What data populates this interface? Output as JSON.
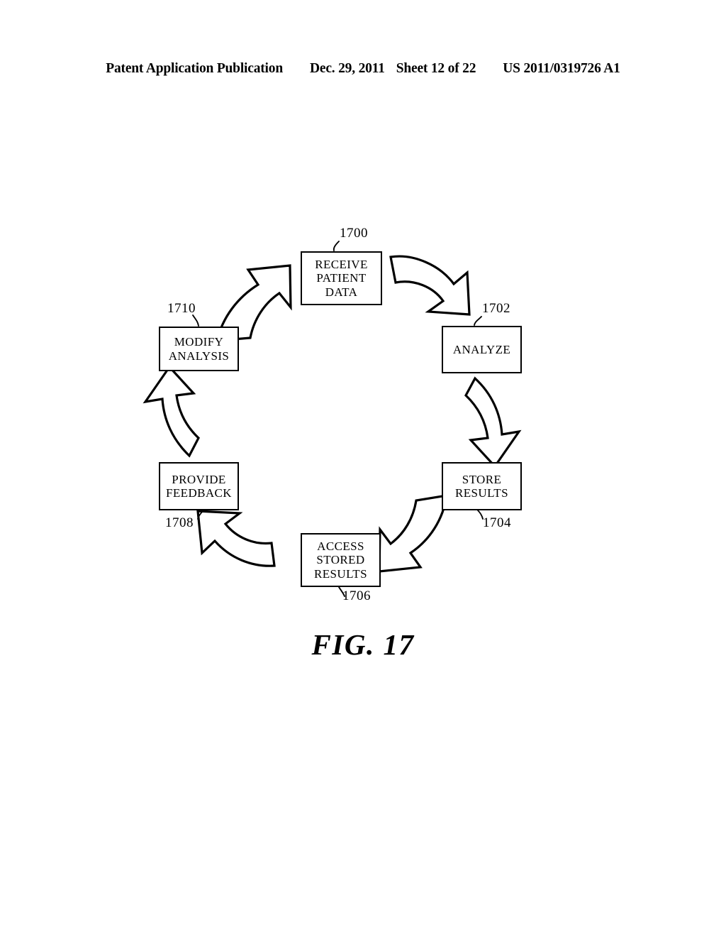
{
  "header": {
    "publication": "Patent Application Publication",
    "date": "Dec. 29, 2011",
    "sheet": "Sheet 12 of 22",
    "patent_number": "US 2011/0319726 A1"
  },
  "figure": {
    "caption": "FIG. 17",
    "type": "cycle-flow-diagram",
    "line_color": "#000000",
    "background_color": "#ffffff"
  },
  "diagram": {
    "nodes": [
      {
        "id": "1700",
        "ref": "1700",
        "position": "top",
        "lines": [
          "RECEIVE",
          "PATIENT",
          "DATA"
        ],
        "text": "RECEIVE PATIENT DATA"
      },
      {
        "id": "1702",
        "ref": "1702",
        "position": "right-upper",
        "lines": [
          "ANALYZE"
        ],
        "text": "ANALYZE"
      },
      {
        "id": "1704",
        "ref": "1704",
        "position": "right-lower",
        "lines": [
          "STORE",
          "RESULTS"
        ],
        "text": "STORE RESULTS"
      },
      {
        "id": "1706",
        "ref": "1706",
        "position": "bottom",
        "lines": [
          "ACCESS",
          "STORED",
          "RESULTS"
        ],
        "text": "ACCESS STORED RESULTS"
      },
      {
        "id": "1708",
        "ref": "1708",
        "position": "left-lower",
        "lines": [
          "PROVIDE",
          "FEEDBACK"
        ],
        "text": "PROVIDE FEEDBACK"
      },
      {
        "id": "1710",
        "ref": "1710",
        "position": "left-upper",
        "lines": [
          "MODIFY",
          "ANALYSIS"
        ],
        "text": "MODIFY ANALYSIS"
      }
    ],
    "arrows": [
      {
        "from": "1700",
        "to": "1702",
        "direction": "down-right",
        "style": "curved-block-arrow"
      },
      {
        "from": "1702",
        "to": "1704",
        "direction": "down",
        "style": "curved-block-arrow"
      },
      {
        "from": "1704",
        "to": "1706",
        "direction": "down-left",
        "style": "curved-block-arrow"
      },
      {
        "from": "1706",
        "to": "1708",
        "direction": "up-left",
        "style": "curved-block-arrow"
      },
      {
        "from": "1708",
        "to": "1710",
        "direction": "up",
        "style": "curved-block-arrow"
      },
      {
        "from": "1710",
        "to": "1700",
        "direction": "up-right",
        "style": "curved-block-arrow"
      }
    ]
  }
}
